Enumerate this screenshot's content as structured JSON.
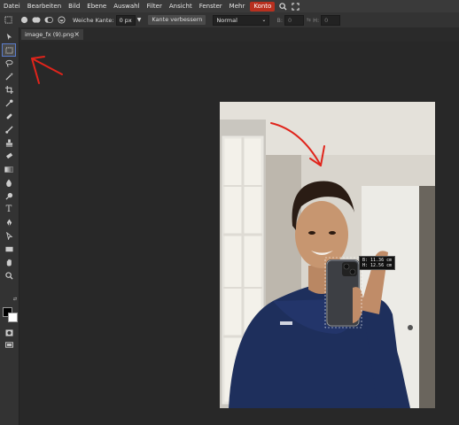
{
  "menubar": {
    "items": [
      "Datei",
      "Bearbeiten",
      "Bild",
      "Ebene",
      "Auswahl",
      "Filter",
      "Ansicht",
      "Fenster",
      "Mehr",
      "Konto"
    ],
    "icons": [
      "search-icon",
      "fullscreen-icon"
    ],
    "konto_color": "#b8301f"
  },
  "options": {
    "feather_label": "Weiche Kante:",
    "feather_value": "0 px",
    "refine_edge_label": "Kante verbessern",
    "mode_value": "Normal",
    "width_label": "B:",
    "width_value": "0",
    "height_label": "H:",
    "height_value": "0"
  },
  "document": {
    "tab_title": "image_fx (9).png",
    "close_symbol": "×"
  },
  "selection_readout": {
    "width": "B: 11.36 cm",
    "height": "H: 12.56 cm"
  },
  "toolbar": {
    "tools": [
      "move-icon",
      "rectangle-select-icon",
      "lasso-icon",
      "magic-wand-icon",
      "crop-icon",
      "eyedropper-icon",
      "spot-heal-icon",
      "brush-icon",
      "clone-stamp-icon",
      "eraser-icon",
      "gradient-icon",
      "blur-icon",
      "dodge-icon",
      "text-icon",
      "pen-icon",
      "path-select-icon",
      "shape-icon",
      "hand-icon",
      "zoom-icon"
    ],
    "active_tool": "rectangle-select-icon",
    "foreground_color": "#000000",
    "background_color": "#ffffff"
  },
  "annotation_color": "#e0241b"
}
